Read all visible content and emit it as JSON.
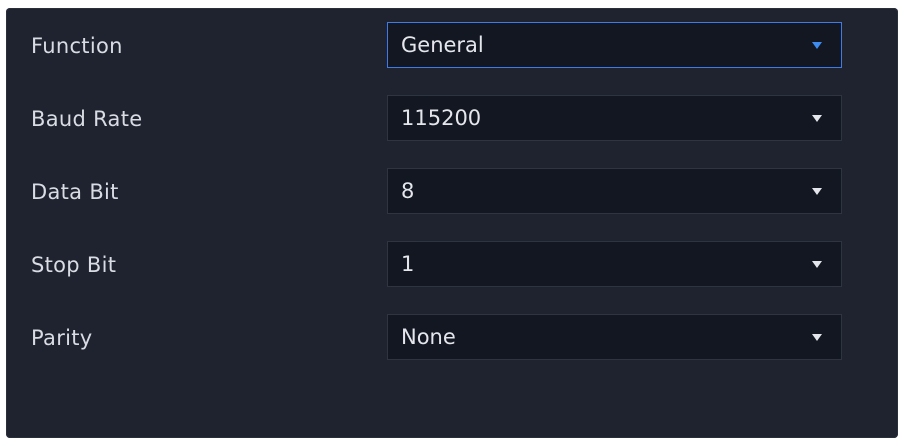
{
  "form": {
    "rows": [
      {
        "label": "Function",
        "value": "General",
        "active": true
      },
      {
        "label": "Baud Rate",
        "value": "115200",
        "active": false
      },
      {
        "label": "Data Bit",
        "value": "8",
        "active": false
      },
      {
        "label": "Stop Bit",
        "value": "1",
        "active": false
      },
      {
        "label": "Parity",
        "value": "None",
        "active": false
      }
    ]
  },
  "icons": {
    "dropdown": "chevron-down-icon"
  },
  "colors": {
    "panel_background": "#1f232f",
    "field_background": "#131721",
    "field_border": "#2f3441",
    "focus_border": "#3f7be6",
    "focus_caret": "#3f8cf0",
    "text": "#e4e6ec"
  }
}
